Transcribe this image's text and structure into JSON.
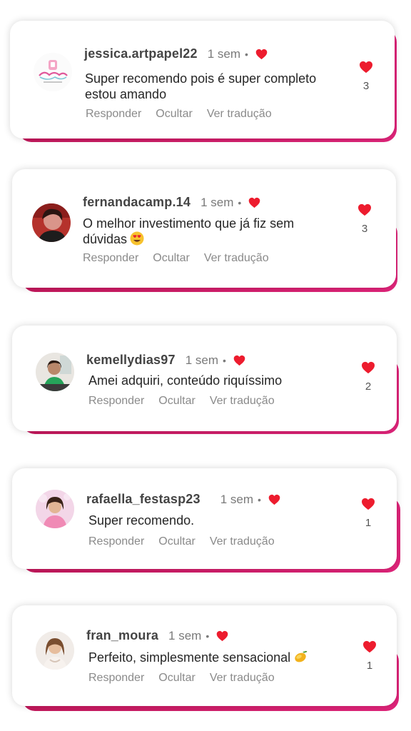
{
  "accent": "#e0247a",
  "heart_color": "#ed1c2e",
  "comments": [
    {
      "username": "jessica.artpapel22",
      "time": "1 sem",
      "text": "Super recomendo pois é super completo estou amando",
      "likes": "3",
      "avatar": "logo-avatar",
      "actions": {
        "reply": "Responder",
        "hide": "Ocultar",
        "translate": "Ver tradução"
      }
    },
    {
      "username": "fernandacamp.14",
      "time": "1 sem",
      "text": "O melhor investimento que já fiz sem dúvidas",
      "emoji": "smiling-face-heart-eyes",
      "likes": "3",
      "avatar": "photo-avatar",
      "actions": {
        "reply": "Responder",
        "hide": "Ocultar",
        "translate": "Ver tradução"
      }
    },
    {
      "username": "kemellydias97",
      "time": "1 sem",
      "text": "Amei adquiri, conteúdo riquíssimo",
      "likes": "2",
      "avatar": "photo-avatar",
      "actions": {
        "reply": "Responder",
        "hide": "Ocultar",
        "translate": "Ver tradução"
      }
    },
    {
      "username": "rafaella_festasp23",
      "time": "1 sem",
      "text": "Super recomendo.",
      "likes": "1",
      "avatar": "photo-avatar",
      "actions": {
        "reply": "Responder",
        "hide": "Ocultar",
        "translate": "Ver tradução"
      }
    },
    {
      "username": "fran_moura",
      "time": "1 sem",
      "text": "Perfeito, simplesmente sensacional",
      "emoji": "mango",
      "likes": "1",
      "avatar": "photo-avatar",
      "actions": {
        "reply": "Responder",
        "hide": "Ocultar",
        "translate": "Ver tradução"
      }
    }
  ]
}
